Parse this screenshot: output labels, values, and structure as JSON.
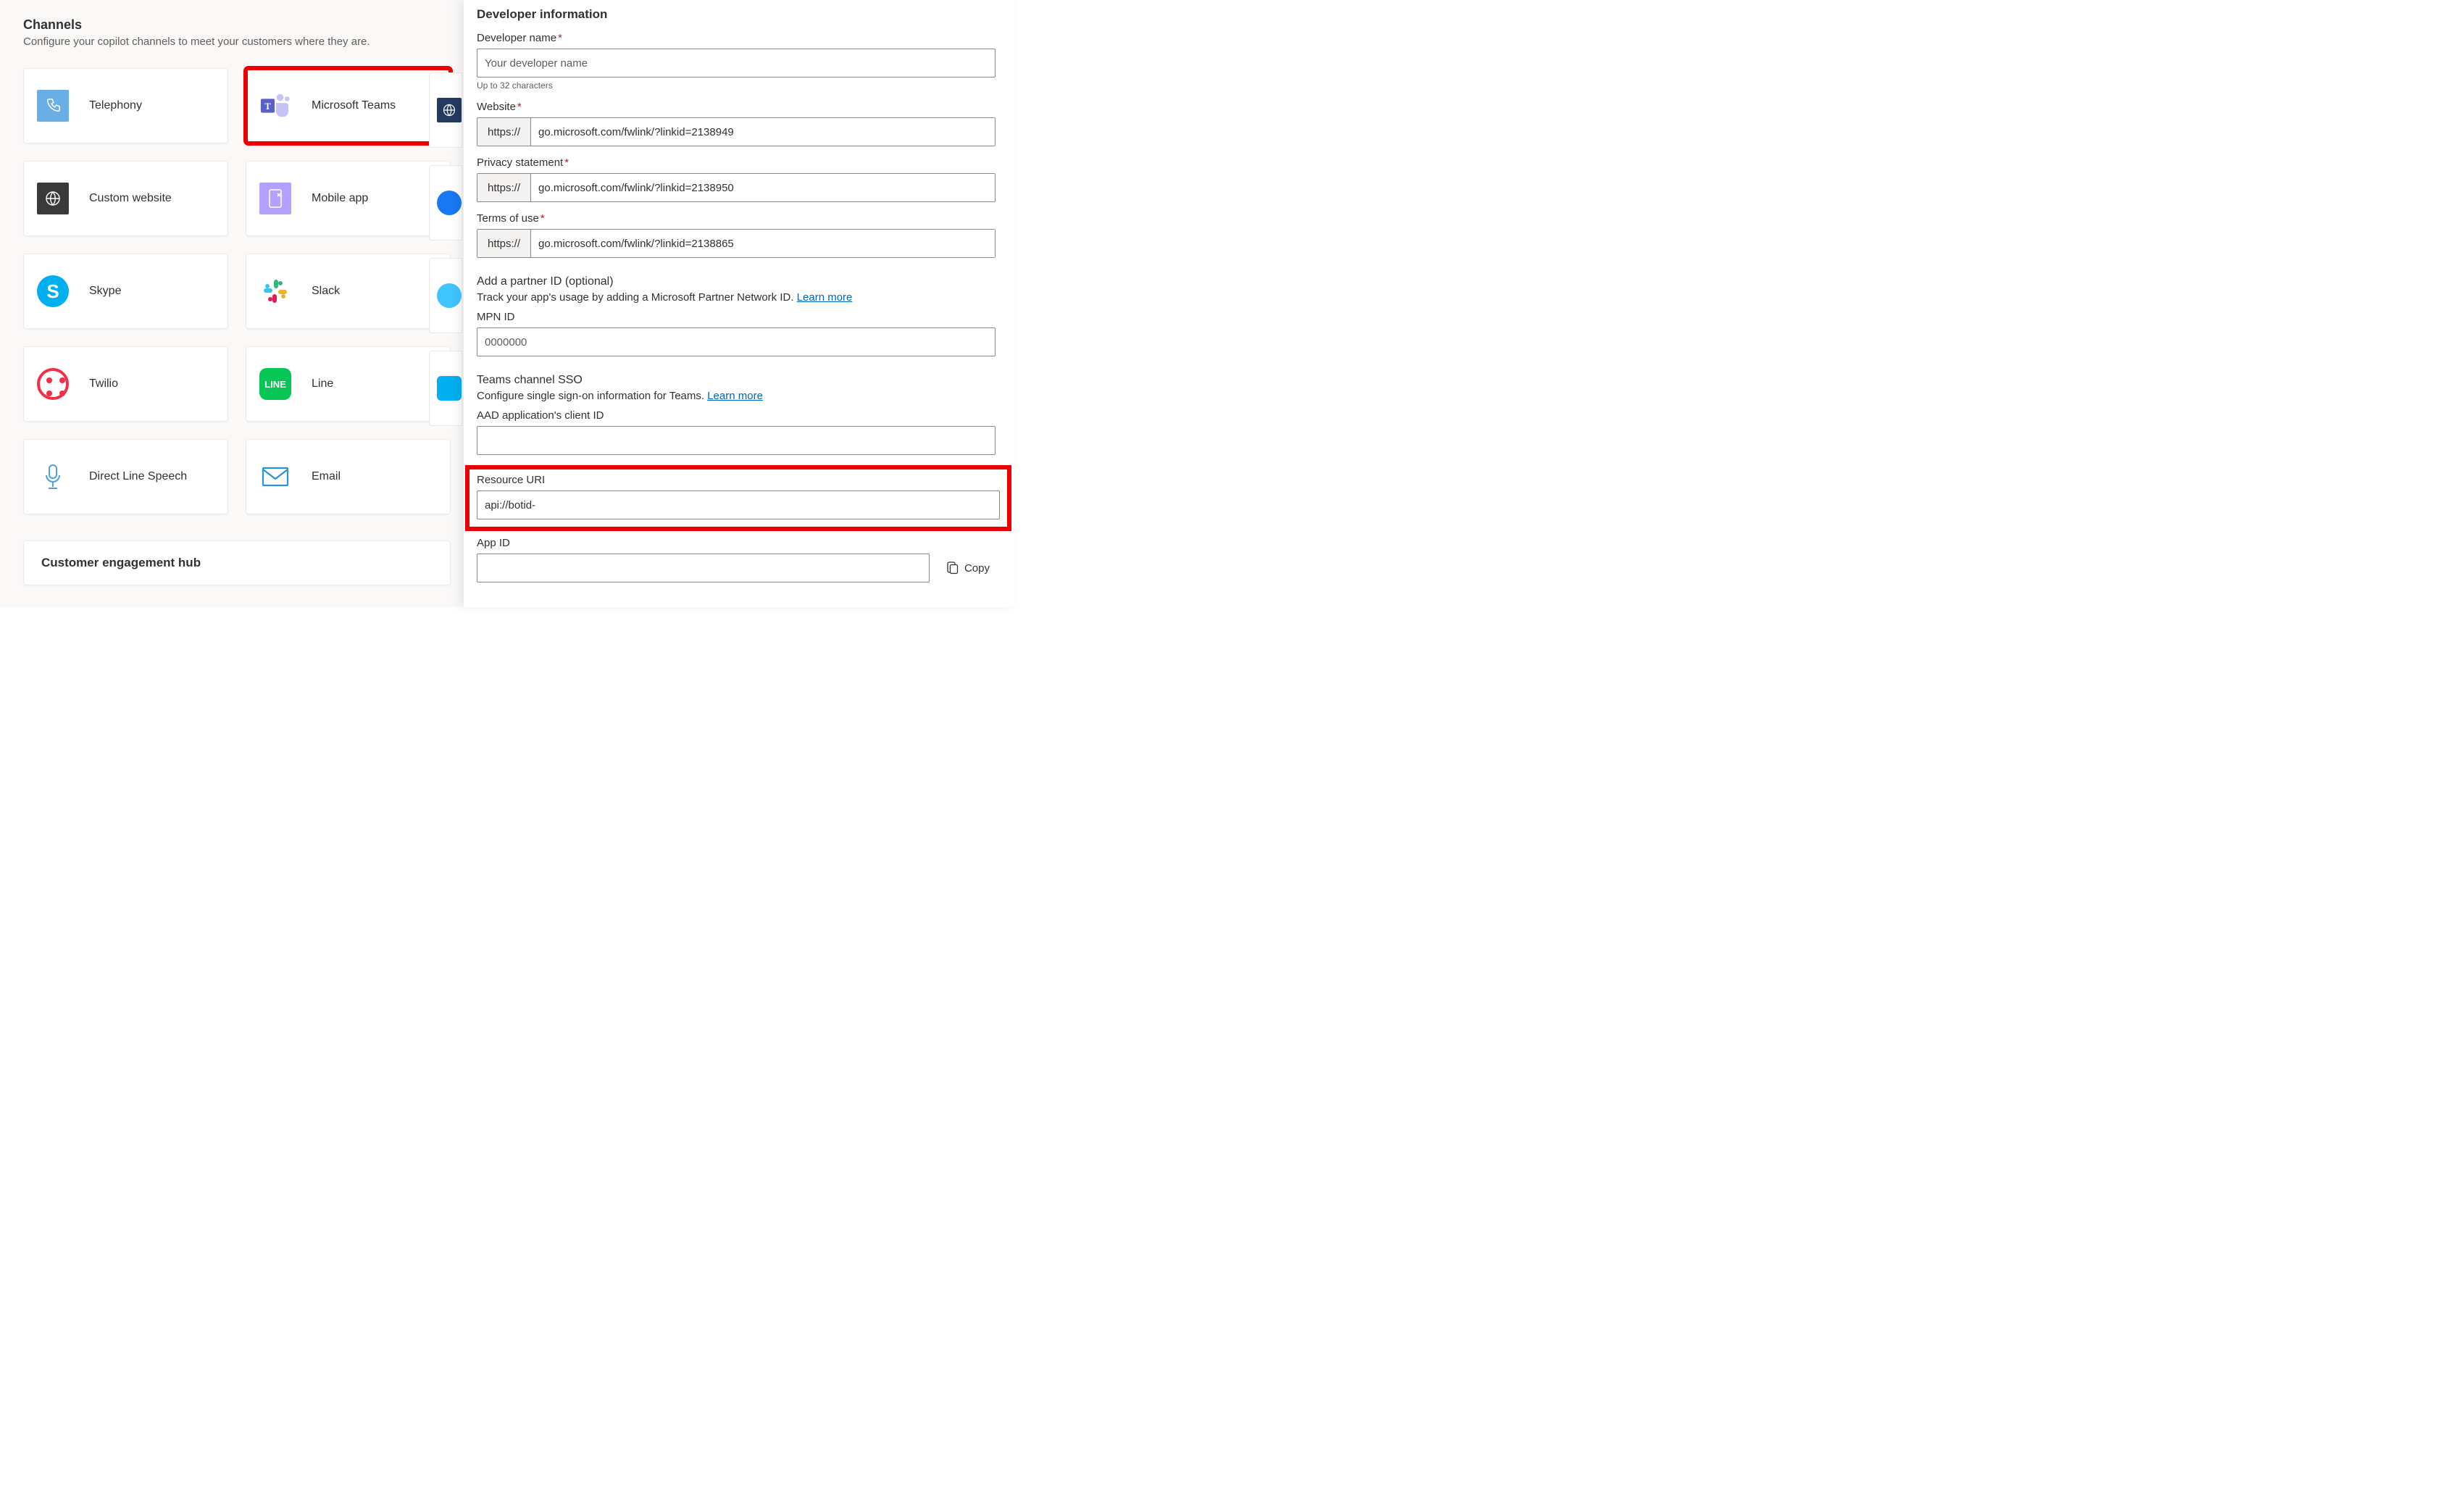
{
  "left": {
    "title": "Channels",
    "subtitle": "Configure your copilot channels to meet your customers where they are.",
    "cards": [
      {
        "id": "telephony",
        "label": "Telephony"
      },
      {
        "id": "teams",
        "label": "Microsoft Teams"
      },
      {
        "id": "custom-website",
        "label": "Custom website"
      },
      {
        "id": "mobile-app",
        "label": "Mobile app"
      },
      {
        "id": "skype",
        "label": "Skype"
      },
      {
        "id": "slack",
        "label": "Slack"
      },
      {
        "id": "twilio",
        "label": "Twilio"
      },
      {
        "id": "line",
        "label": "Line"
      },
      {
        "id": "direct-line-speech",
        "label": "Direct Line Speech"
      },
      {
        "id": "email",
        "label": "Email"
      }
    ],
    "hub_title": "Customer engagement hub"
  },
  "right": {
    "section_title": "Developer information",
    "dev_name": {
      "label": "Developer name",
      "placeholder": "Your developer name",
      "hint": "Up to 32 characters"
    },
    "website": {
      "label": "Website",
      "prefix": "https://",
      "value": "go.microsoft.com/fwlink/?linkid=2138949"
    },
    "privacy": {
      "label": "Privacy statement",
      "prefix": "https://",
      "value": "go.microsoft.com/fwlink/?linkid=2138950"
    },
    "terms": {
      "label": "Terms of use",
      "prefix": "https://",
      "value": "go.microsoft.com/fwlink/?linkid=2138865"
    },
    "partner": {
      "heading": "Add a partner ID (optional)",
      "desc": "Track your app's usage by adding a Microsoft Partner Network ID. ",
      "learn": "Learn more",
      "mpn_label": "MPN ID",
      "mpn_placeholder": "0000000"
    },
    "sso": {
      "heading": "Teams channel SSO",
      "desc": "Configure single sign-on information for Teams. ",
      "learn": "Learn more",
      "aad_label": "AAD application's client ID",
      "aad_value": "",
      "res_label": "Resource URI",
      "res_value": "api://botid-",
      "appid_label": "App ID",
      "appid_value": "",
      "copy": "Copy"
    }
  }
}
